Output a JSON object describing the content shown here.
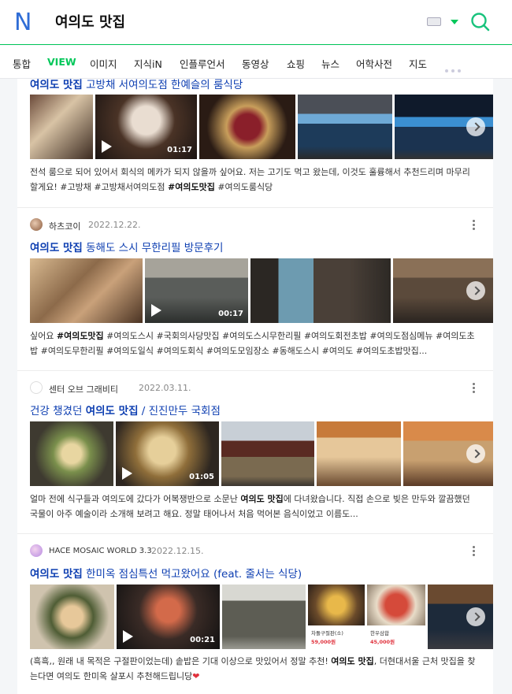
{
  "header": {
    "query": "여의도 맛집",
    "logo": "N"
  },
  "tabs": [
    "통합",
    "VIEW",
    "이미지",
    "지식iN",
    "인플루언서",
    "동영상",
    "쇼핑",
    "뉴스",
    "어학사전",
    "지도"
  ],
  "posts": [
    {
      "title_prefix": "여의도 맛집",
      "title_rest": " 고방채 서여의도점 한예슬의 룸식당",
      "desc": "전석 룸으로 되어 있어서 회식의 메카가 되지 않을까 싶어요. 저는 고기도 먹고 왔는데, 이것도 훌륭해서 추천드리며 마무리 할게요! #고방채 #고방채서여의도점 ",
      "desc_bold": "#여의도맛집",
      "desc_end": " #여의도룸식당",
      "video_duration": "01:17"
    },
    {
      "author": "하츠코이",
      "date": "2022.12.22.",
      "title_prefix": "여의도 맛집",
      "title_rest": " 동해도 스시 무한리필 방문후기",
      "desc_start": "싶어요 ",
      "desc_bold": "#여의도맛집",
      "desc": " #여의도스시 #국회의사당맛집 #여의도스시무한리필 #여의도회전초밥 #여의도점심메뉴 #여의도초밥 #여의도무한리필 #여의도일식 #여의도회식 #여의도모임장소 #동해도스시 #여의도 #여의도초밥맛집...",
      "video_duration": "00:17"
    },
    {
      "author": "센터 오브 그래비티",
      "date": "2022.03.11.",
      "title_start": "건강 챙겼던 ",
      "title_prefix": "여의도 맛집",
      "title_rest": " / 진진만두 국회점",
      "desc_start": "얼마 전에 식구들과 여의도에 갔다가 어복쟁반으로 소문난 ",
      "desc_bold": "여의도 맛집",
      "desc": "에 다녀왔습니다. 직접 손으로 빚은 만두와 깔끔했던 국물이 아주 예술이라 소개해 보려고 해요. 정말 태어나서 처음 먹어본 음식이었고 이름도...",
      "video_duration": "01:05"
    },
    {
      "author": "HACE MOSAIC WORLD 3.3",
      "date": "2022.12.15.",
      "title_prefix": "여의도 맛집",
      "title_rest": " 한미옥 점심특선 먹고왔어요 (feat. 줄서는 식당)",
      "desc_start": "(흑흑,, 원래 내 목적은 구절판이었는데) 솥밥은 기대 이상으로 맛있어서 정말 추천! ",
      "desc_bold": "여의도 맛집",
      "desc": ", 더현대서울 근처 맛집을 찾는다면 여의도 한미옥 살포시 추천해드립니당",
      "video_duration": "00:21",
      "thumb_label_1": "차돌구절판(소)",
      "thumb_price_1": "59,000원",
      "thumb_label_2": "한우삼합",
      "thumb_price_2": "45,000원"
    }
  ]
}
